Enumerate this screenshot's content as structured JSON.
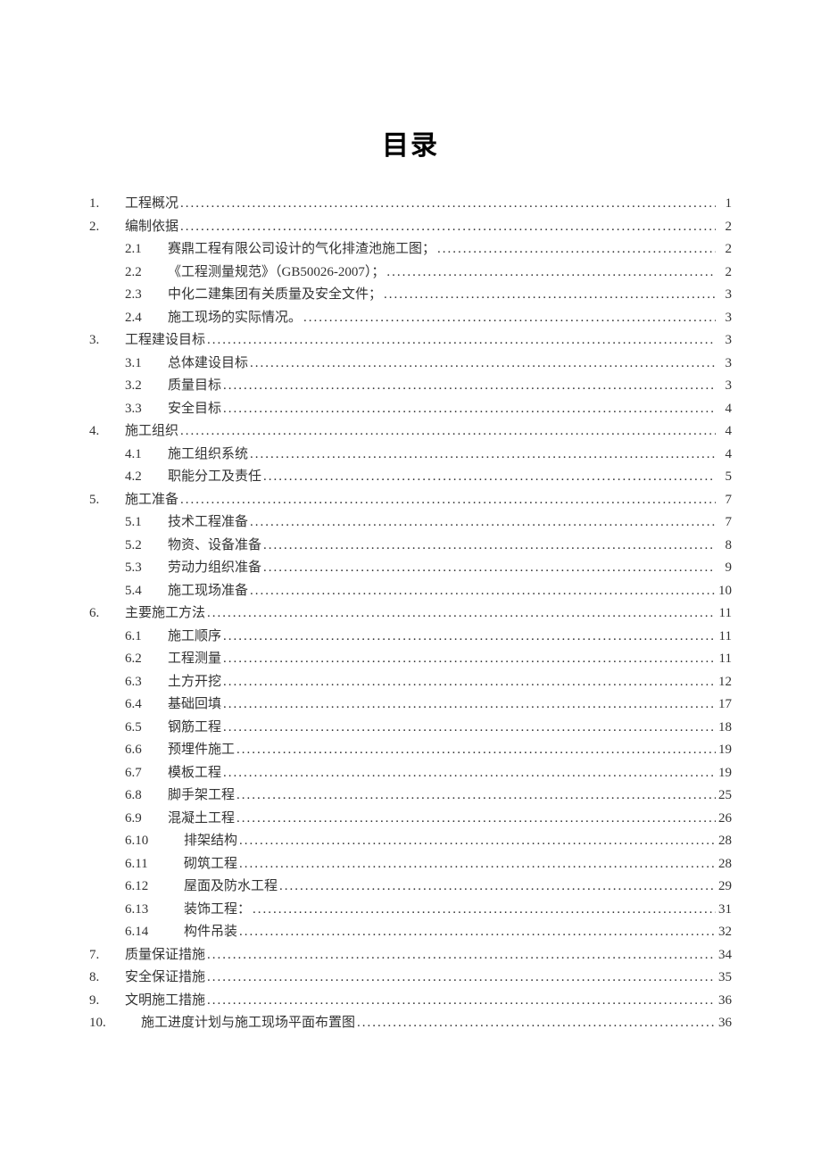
{
  "title": "目录",
  "toc": [
    {
      "level": 1,
      "num": "1.",
      "text": "工程概况",
      "page": "1"
    },
    {
      "level": 1,
      "num": "2.",
      "text": "编制依据",
      "page": "2"
    },
    {
      "level": 2,
      "num": "2.1",
      "text": "赛鼎工程有限公司设计的气化排渣池施工图；",
      "page": "2"
    },
    {
      "level": 2,
      "num": "2.2",
      "text": "《工程测量规范》（GB50026-2007）；",
      "page": "2"
    },
    {
      "level": 2,
      "num": "2.3",
      "text": "中化二建集团有关质量及安全文件；",
      "page": "3"
    },
    {
      "level": 2,
      "num": "2.4",
      "text": "施工现场的实际情况。",
      "page": "3"
    },
    {
      "level": 1,
      "num": "3.",
      "text": "工程建设目标",
      "page": "3"
    },
    {
      "level": 2,
      "num": "3.1",
      "text": "总体建设目标",
      "page": "3"
    },
    {
      "level": 2,
      "num": "3.2",
      "text": "质量目标",
      "page": "3"
    },
    {
      "level": 2,
      "num": "3.3",
      "text": "安全目标",
      "page": "4"
    },
    {
      "level": 1,
      "num": "4.",
      "text": "施工组织",
      "page": "4"
    },
    {
      "level": 2,
      "num": "4.1",
      "text": "施工组织系统",
      "page": "4"
    },
    {
      "level": 2,
      "num": "4.2",
      "text": "职能分工及责任",
      "page": "5"
    },
    {
      "level": 1,
      "num": "5.",
      "text": "施工准备",
      "page": "7"
    },
    {
      "level": 2,
      "num": "5.1",
      "text": "技术工程准备",
      "page": "7"
    },
    {
      "level": 2,
      "num": "5.2",
      "text": "物资、设备准备",
      "page": "8"
    },
    {
      "level": 2,
      "num": "5.3",
      "text": "劳动力组织准备",
      "page": "9"
    },
    {
      "level": 2,
      "num": "5.4",
      "text": "施工现场准备",
      "page": "10"
    },
    {
      "level": 1,
      "num": "6.",
      "text": "主要施工方法",
      "page": "11"
    },
    {
      "level": 2,
      "num": "6.1",
      "text": "施工顺序",
      "page": "11"
    },
    {
      "level": 2,
      "num": "6.2",
      "text": "工程测量",
      "page": "11"
    },
    {
      "level": 2,
      "num": "6.3",
      "text": "土方开挖",
      "page": "12"
    },
    {
      "level": 2,
      "num": "6.4",
      "text": "基础回填",
      "page": "17"
    },
    {
      "level": 2,
      "num": "6.5",
      "text": "钢筋工程",
      "page": "18"
    },
    {
      "level": 2,
      "num": "6.6",
      "text": "预埋件施工",
      "page": "19"
    },
    {
      "level": 2,
      "num": "6.7",
      "text": "模板工程",
      "page": "19"
    },
    {
      "level": 2,
      "num": "6.8",
      "text": "脚手架工程",
      "page": "25"
    },
    {
      "level": 2,
      "num": "6.9",
      "text": "混凝土工程",
      "page": "26"
    },
    {
      "level": "2b",
      "num": "6.10",
      "text": "排架结构",
      "page": "28"
    },
    {
      "level": "2b",
      "num": "6.11",
      "text": "砌筑工程",
      "page": "28"
    },
    {
      "level": "2b",
      "num": "6.12",
      "text": "屋面及防水工程",
      "page": "29"
    },
    {
      "level": "2b",
      "num": "6.13",
      "text": "装饰工程：",
      "page": "31"
    },
    {
      "level": "2b",
      "num": "6.14",
      "text": "构件吊装",
      "page": "32"
    },
    {
      "level": 1,
      "num": "7.",
      "text": "质量保证措施",
      "page": "34"
    },
    {
      "level": 1,
      "num": "8.",
      "text": "安全保证措施",
      "page": "35"
    },
    {
      "level": 1,
      "num": "9.",
      "text": "文明施工措施",
      "page": "36"
    },
    {
      "level": 1,
      "num": "10.",
      "text": "施工进度计划与施工现场平面布置图",
      "page": "36",
      "indent": true
    }
  ]
}
